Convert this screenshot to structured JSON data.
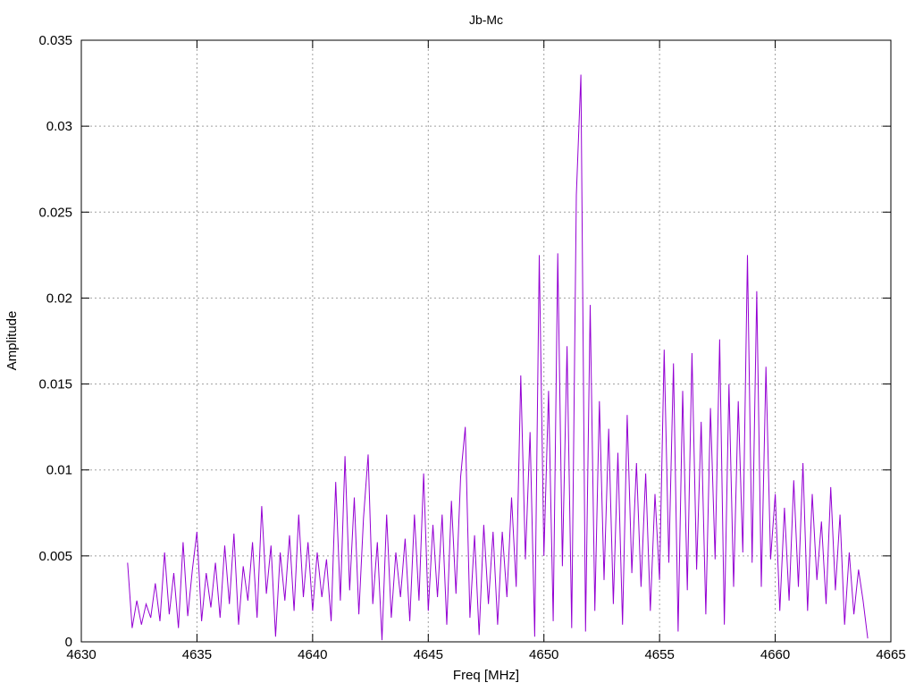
{
  "chart_data": {
    "type": "line",
    "title": "Jb-Mc",
    "xlabel": "Freq [MHz]",
    "ylabel": "Amplitude",
    "xlim": [
      4630,
      4665
    ],
    "ylim": [
      0,
      0.035
    ],
    "xticks": [
      4630,
      4635,
      4640,
      4645,
      4650,
      4655,
      4660,
      4665
    ],
    "xtick_labels": [
      "4630",
      "4635",
      "4640",
      "4645",
      "4650",
      "4655",
      "4660",
      "4665"
    ],
    "yticks": [
      0,
      0.005,
      0.01,
      0.015,
      0.02,
      0.025,
      0.03,
      0.035
    ],
    "ytick_labels": [
      "0",
      "0.005",
      "0.01",
      "0.015",
      "0.02",
      "0.025",
      "0.03",
      "0.035"
    ],
    "grid": true,
    "legend": "none",
    "series": [
      {
        "name": "Jb-Mc",
        "color": "#9400d3",
        "x_start": 4632.0,
        "x_step": 0.2,
        "values": [
          0.0046,
          0.0008,
          0.0024,
          0.001,
          0.0022,
          0.0014,
          0.0034,
          0.0012,
          0.0052,
          0.0016,
          0.004,
          0.0008,
          0.0058,
          0.0015,
          0.0042,
          0.0064,
          0.0012,
          0.004,
          0.002,
          0.0046,
          0.0014,
          0.0056,
          0.0022,
          0.0063,
          0.001,
          0.0044,
          0.0024,
          0.0058,
          0.0014,
          0.0079,
          0.0028,
          0.0056,
          0.0003,
          0.0052,
          0.0024,
          0.0062,
          0.0018,
          0.0074,
          0.0026,
          0.0058,
          0.0018,
          0.0052,
          0.0026,
          0.0048,
          0.0012,
          0.0093,
          0.0024,
          0.0108,
          0.003,
          0.0084,
          0.0016,
          0.0072,
          0.0109,
          0.0022,
          0.0058,
          0.0001,
          0.0074,
          0.0014,
          0.0052,
          0.0026,
          0.006,
          0.0012,
          0.0074,
          0.0024,
          0.0098,
          0.0018,
          0.0068,
          0.0026,
          0.0074,
          0.001,
          0.0082,
          0.0028,
          0.0096,
          0.0125,
          0.0014,
          0.0062,
          0.0004,
          0.0068,
          0.0022,
          0.0064,
          0.001,
          0.0064,
          0.0026,
          0.0084,
          0.0032,
          0.0155,
          0.0048,
          0.0122,
          0.0003,
          0.0225,
          0.005,
          0.0146,
          0.0012,
          0.0226,
          0.0044,
          0.0172,
          0.0008,
          0.026,
          0.033,
          0.0006,
          0.0196,
          0.0018,
          0.014,
          0.0036,
          0.0124,
          0.0022,
          0.011,
          0.001,
          0.0132,
          0.004,
          0.0104,
          0.0032,
          0.0098,
          0.0018,
          0.0086,
          0.0036,
          0.017,
          0.0046,
          0.0162,
          0.0006,
          0.0146,
          0.003,
          0.0168,
          0.0042,
          0.0128,
          0.0016,
          0.0136,
          0.0048,
          0.0176,
          0.001,
          0.015,
          0.0032,
          0.014,
          0.0052,
          0.0225,
          0.0046,
          0.0204,
          0.0032,
          0.016,
          0.0048,
          0.0086,
          0.0018,
          0.0078,
          0.0024,
          0.0094,
          0.0032,
          0.0104,
          0.0018,
          0.0086,
          0.0036,
          0.007,
          0.0022,
          0.009,
          0.003,
          0.0074,
          0.001,
          0.0052,
          0.0016,
          0.0042,
          0.0024,
          0.0002
        ]
      }
    ]
  }
}
